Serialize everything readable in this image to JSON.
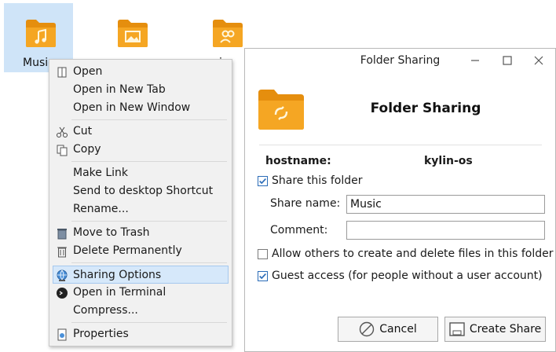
{
  "desktop": {
    "files": [
      {
        "label": "Music",
        "icon": "music-folder-icon"
      },
      {
        "label": "",
        "icon": "pictures-folder-icon"
      },
      {
        "label": "i",
        "icon": "people-folder-icon"
      }
    ]
  },
  "context_menu": {
    "items": [
      {
        "label": "Open",
        "icon": "open-icon"
      },
      {
        "label": "Open in New Tab"
      },
      {
        "label": "Open in New Window"
      },
      {
        "label": "Cut",
        "icon": "scissors-icon"
      },
      {
        "label": "Copy",
        "icon": "copy-icon"
      },
      {
        "label": "Make Link"
      },
      {
        "label": "Send to desktop Shortcut"
      },
      {
        "label": "Rename..."
      },
      {
        "label": "Move to Trash",
        "icon": "trash-icon"
      },
      {
        "label": "Delete Permanently",
        "icon": "delete-icon"
      },
      {
        "label": "Sharing Options",
        "icon": "sharing-icon",
        "highlighted": true
      },
      {
        "label": "Open in Terminal",
        "icon": "terminal-icon"
      },
      {
        "label": "Compress..."
      },
      {
        "label": "Properties",
        "icon": "properties-icon"
      }
    ]
  },
  "dialog": {
    "window_title": "Folder Sharing",
    "heading": "Folder Sharing",
    "hostname_label": "hostname:",
    "hostname_value": "kylin-os",
    "share_this_folder": {
      "label": "Share this folder",
      "checked": true
    },
    "share_name": {
      "label": "Share name:",
      "value": "Music"
    },
    "comment": {
      "label": "Comment:",
      "value": ""
    },
    "allow_others": {
      "label": "Allow others to create and delete files in this folder",
      "checked": false
    },
    "guest_access": {
      "label": "Guest access (for people without a user account)",
      "checked": true
    },
    "cancel_label": "Cancel",
    "create_share_label": "Create Share"
  },
  "colors": {
    "folder_orange": "#f5a623",
    "folder_dark": "#e58e0e",
    "selection_blue": "#cfe4f8",
    "menu_highlight": "#d6e8fa",
    "checkbox_blue": "#2b6cb8"
  }
}
